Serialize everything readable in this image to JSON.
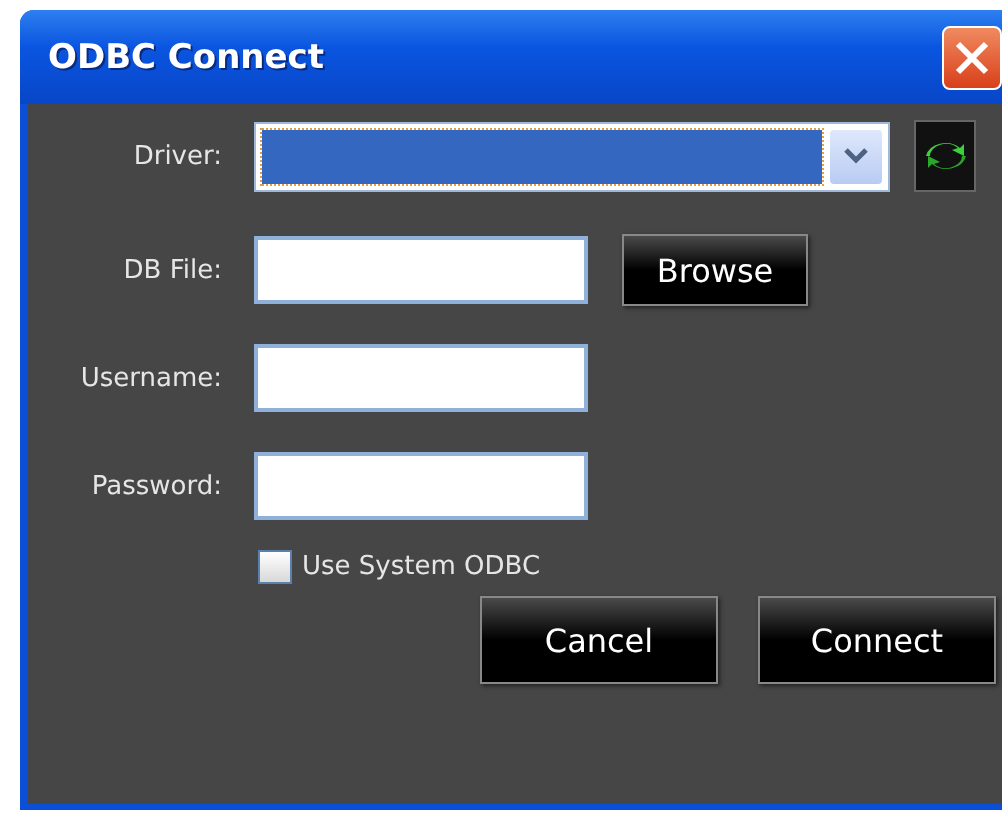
{
  "window": {
    "title": "ODBC Connect"
  },
  "driver": {
    "label": "Driver:"
  },
  "fields": [
    {
      "label": "DB File:",
      "button": "Browse"
    },
    {
      "label": "Username:"
    },
    {
      "label": "Password:"
    }
  ],
  "use_system_odbc": {
    "label": "Use System ODBC",
    "checked": false
  },
  "buttons": [
    "Cancel",
    "Connect"
  ]
}
